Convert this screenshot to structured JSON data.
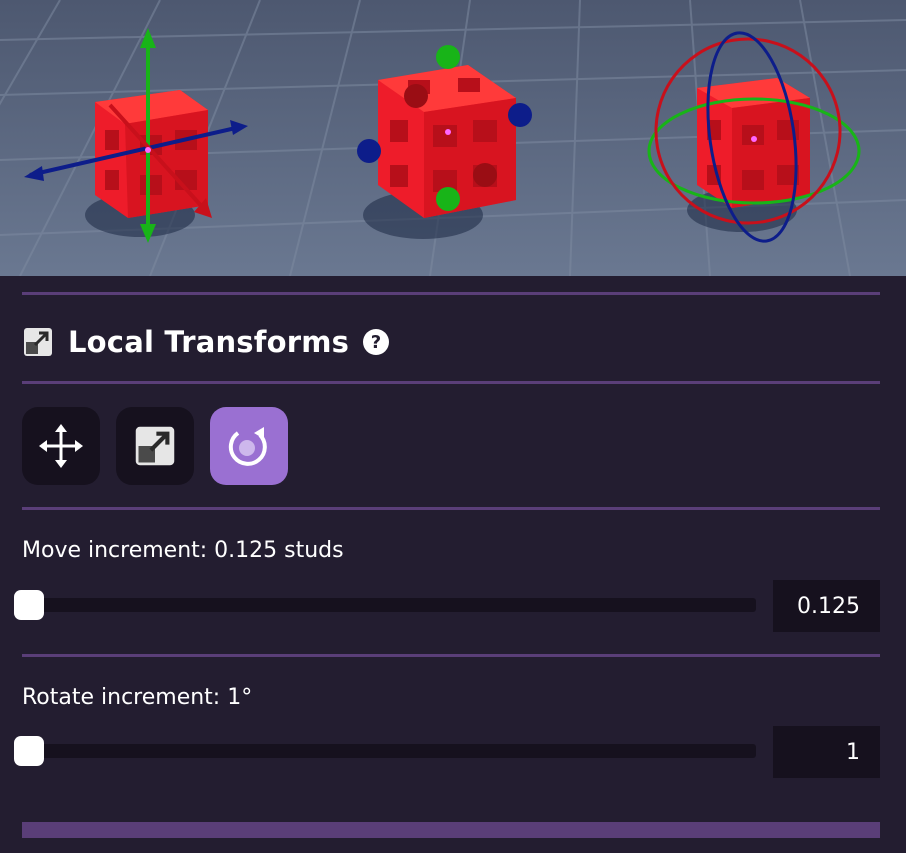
{
  "viewport": {
    "scenes": [
      {
        "name": "move-gizmo-preview"
      },
      {
        "name": "scale-gizmo-preview"
      },
      {
        "name": "rotate-gizmo-preview"
      }
    ]
  },
  "panel": {
    "title": "Local Transforms",
    "title_icon": "resize-icon",
    "help_icon": "help-icon",
    "tools": [
      {
        "name": "move-tool",
        "icon": "move-arrows-icon",
        "active": false
      },
      {
        "name": "scale-tool",
        "icon": "resize-icon",
        "active": false
      },
      {
        "name": "rotate-tool",
        "icon": "rotate-icon",
        "active": true
      }
    ],
    "move_increment": {
      "label": "Move increment: 0.125 studs",
      "value": "0.125",
      "slider_fraction": 0
    },
    "rotate_increment": {
      "label": "Rotate increment: 1°",
      "value": "1",
      "slider_fraction": 0
    }
  },
  "colors": {
    "panel_bg": "#231d30",
    "divider": "#5a3e78",
    "active_tool": "#9a70d2",
    "inactive_tool": "#16111e",
    "cube_red": "#ee1c2a",
    "axis_red": "#c8101b",
    "axis_green": "#18b418",
    "axis_blue": "#0d1d8a"
  }
}
